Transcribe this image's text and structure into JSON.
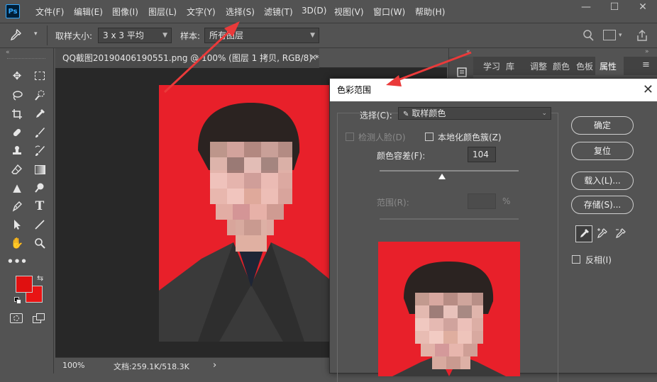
{
  "app": {
    "logo": "Ps"
  },
  "menu": [
    "文件(F)",
    "编辑(E)",
    "图像(I)",
    "图层(L)",
    "文字(Y)",
    "选择(S)",
    "滤镜(T)",
    "3D(D)",
    "视图(V)",
    "窗口(W)",
    "帮助(H)"
  ],
  "window_controls": {
    "minimize": "—",
    "maximize": "☐",
    "close": "✕"
  },
  "options": {
    "sample_size_label": "取样大小:",
    "sample_size_value": "3 x 3 平均",
    "sample_label": "样本:",
    "sample_value": "所有图层"
  },
  "document_tab": {
    "title": "QQ截图20190406190551.png @ 100% (图层 1 拷贝, RGB/8) *",
    "close": "×"
  },
  "status": {
    "zoom": "100%",
    "doc_info": "文档:259.1K/518.3K",
    "arrow": "›"
  },
  "right_panel": {
    "tabs": [
      "学习",
      "库",
      "调整",
      "颜色",
      "色板",
      "属性"
    ]
  },
  "colors": {
    "foreground": "#e01010",
    "background": "#e81414",
    "photo_bg": "#e8202a",
    "arrow": "#ea3a3a"
  },
  "dialog": {
    "title": "色彩范围",
    "close": "✕",
    "select_label": "选择(C):",
    "select_value": "取样颜色",
    "detect_faces": "检测人脸(D)",
    "localized_clusters": "本地化颜色簇(Z)",
    "fuzziness_label": "颜色容差(F):",
    "fuzziness_value": "104",
    "fuzziness_level": 0.45,
    "range_label": "范围(R):",
    "range_unit": "%",
    "ok": "确定",
    "reset": "复位",
    "load": "载入(L)...",
    "save": "存储(S)...",
    "invert": "反相(I)"
  }
}
